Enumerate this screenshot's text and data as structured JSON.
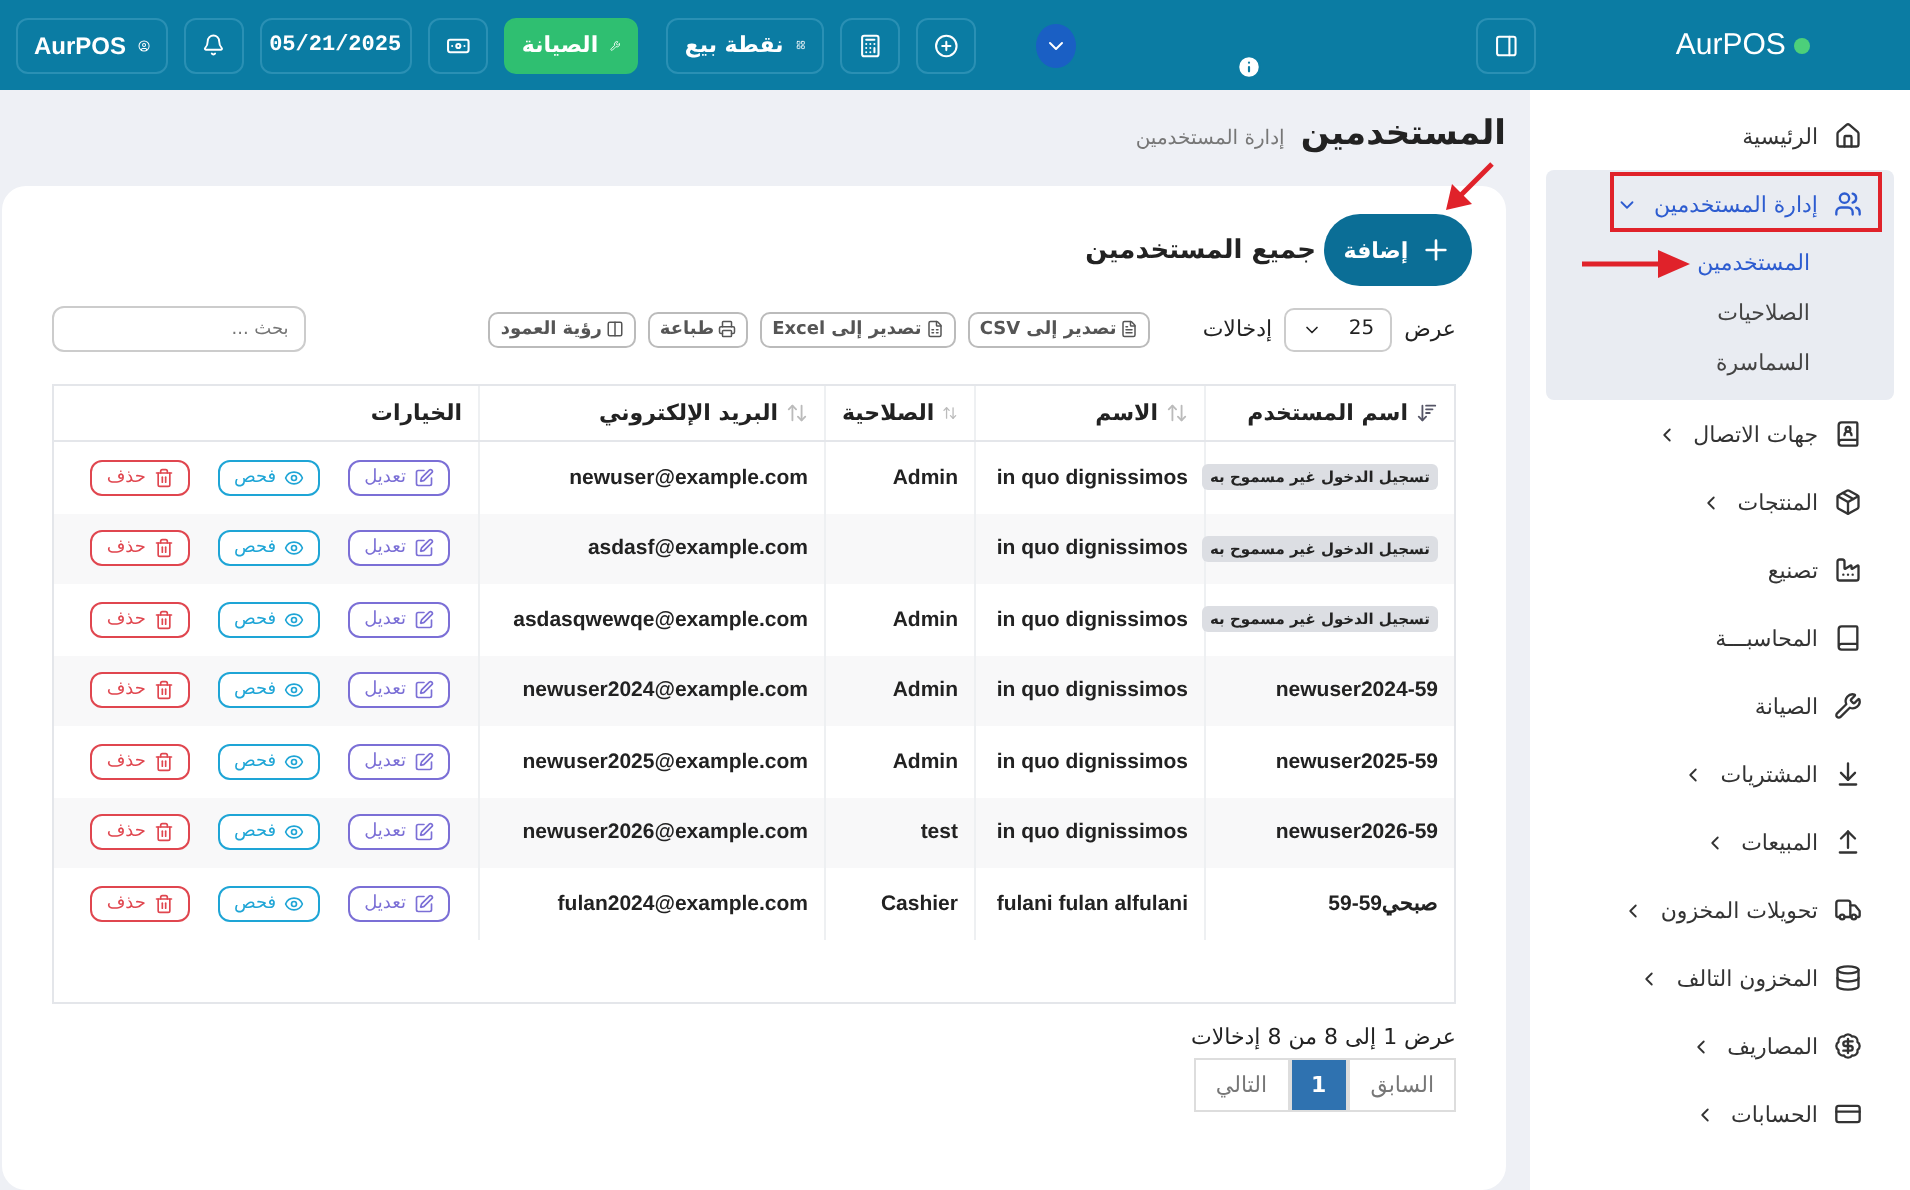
{
  "topbar": {
    "brand": "AurPOS",
    "maintenance_label": "الصيانة",
    "pos_label": "نقطة بيع",
    "date": "05/21/2025",
    "user": "AurPOS"
  },
  "sidebar": {
    "items": [
      {
        "label": "الرئيسية",
        "has_submenu": false,
        "expanded": false
      },
      {
        "label": "إدارة المستخدمين",
        "has_submenu": true,
        "expanded": true,
        "children": [
          {
            "label": "المستخدمين",
            "selected": true
          },
          {
            "label": "الصلاحيات",
            "selected": false
          },
          {
            "label": "السماسرة",
            "selected": false
          }
        ]
      },
      {
        "label": "جهات الاتصال",
        "has_submenu": true,
        "expanded": false
      },
      {
        "label": "المنتجات",
        "has_submenu": true,
        "expanded": false
      },
      {
        "label": "تصنيع",
        "has_submenu": false,
        "expanded": false
      },
      {
        "label": "المحاسبـــة",
        "has_submenu": false,
        "expanded": false
      },
      {
        "label": "الصيانة",
        "has_submenu": false,
        "expanded": false
      },
      {
        "label": "المشتريات",
        "has_submenu": true,
        "expanded": false
      },
      {
        "label": "المبيعات",
        "has_submenu": true,
        "expanded": false
      },
      {
        "label": "تحويلات المخزون",
        "has_submenu": true,
        "expanded": false
      },
      {
        "label": "المخزون التالف",
        "has_submenu": true,
        "expanded": false
      },
      {
        "label": "المصاريف",
        "has_submenu": true,
        "expanded": false
      },
      {
        "label": "الحسابات",
        "has_submenu": true,
        "expanded": false
      }
    ]
  },
  "page": {
    "title": "المستخدمين",
    "breadcrumb": "إدارة المستخدمين"
  },
  "card": {
    "title": "جميع المستخدمين",
    "add_button": "إضافة"
  },
  "controls": {
    "show_label": "عرض",
    "page_size": "25",
    "entries_label": "إدخالات",
    "buttons": [
      {
        "kind": "csv",
        "label": "تصدير إلى CSV"
      },
      {
        "kind": "excel",
        "label": "تصدير إلى Excel"
      },
      {
        "kind": "print",
        "label": "طباعة"
      },
      {
        "kind": "columns",
        "label": "رؤية العمود"
      }
    ],
    "search": {
      "placeholder": "بحث ..."
    }
  },
  "table": {
    "columns": [
      {
        "label": "اسم المستخدم",
        "sortable": true,
        "sorted": true
      },
      {
        "label": "الاسم",
        "sortable": true,
        "sorted": false
      },
      {
        "label": "الصلاحية",
        "sortable": true,
        "sorted": false
      },
      {
        "label": "البريد الإلكتروني",
        "sortable": true,
        "sorted": false
      },
      {
        "label": "الخيارات",
        "sortable": false
      }
    ],
    "rows": [
      {
        "username": {
          "kind": "badge",
          "text": "تسجيل الدخول غير مسموح به"
        },
        "name": "in quo dignissimos",
        "role": "Admin",
        "email": "newuser@example.com",
        "actions": [
          {
            "kind": "edit",
            "label": "تعديل"
          },
          {
            "kind": "view",
            "label": "فحص"
          },
          {
            "kind": "delete",
            "label": "حذف"
          }
        ]
      },
      {
        "username": {
          "kind": "badge",
          "text": "تسجيل الدخول غير مسموح به"
        },
        "name": "in quo dignissimos",
        "email": "asdasf@example.com",
        "actions": [
          {
            "kind": "edit",
            "label": "تعديل"
          },
          {
            "kind": "view",
            "label": "فحص"
          },
          {
            "kind": "delete",
            "label": "حذف"
          }
        ]
      },
      {
        "username": {
          "kind": "badge",
          "text": "تسجيل الدخول غير مسموح به"
        },
        "name": "in quo dignissimos",
        "role": "Admin",
        "email": "asdasqwewqe@example.com",
        "actions": [
          {
            "kind": "edit",
            "label": "تعديل"
          },
          {
            "kind": "view",
            "label": "فحص"
          },
          {
            "kind": "delete",
            "label": "حذف"
          }
        ]
      },
      {
        "username": {
          "kind": "text",
          "text": "newuser2024-59"
        },
        "name": "in quo dignissimos",
        "role": "Admin",
        "email": "newuser2024@example.com",
        "actions": [
          {
            "kind": "edit",
            "label": "تعديل"
          },
          {
            "kind": "view",
            "label": "فحص"
          },
          {
            "kind": "delete",
            "label": "حذف"
          }
        ]
      },
      {
        "username": {
          "kind": "text",
          "text": "newuser2025-59"
        },
        "name": "in quo dignissimos",
        "role": "Admin",
        "email": "newuser2025@example.com",
        "actions": [
          {
            "kind": "edit",
            "label": "تعديل"
          },
          {
            "kind": "view",
            "label": "فحص"
          },
          {
            "kind": "delete",
            "label": "حذف"
          }
        ]
      },
      {
        "username": {
          "kind": "text",
          "text": "newuser2026-59"
        },
        "name": "in quo dignissimos",
        "role": "test",
        "email": "newuser2026@example.com",
        "actions": [
          {
            "kind": "edit",
            "label": "تعديل"
          },
          {
            "kind": "view",
            "label": "فحص"
          },
          {
            "kind": "delete",
            "label": "حذف"
          }
        ]
      },
      {
        "username": {
          "kind": "text",
          "text": "صبحي59-59"
        },
        "name": "fulani fulan alfulani",
        "role": "Cashier",
        "email": "fulan2024@example.com",
        "actions": [
          {
            "kind": "edit",
            "label": "تعديل"
          },
          {
            "kind": "view",
            "label": "فحص"
          },
          {
            "kind": "delete",
            "label": "حذف"
          }
        ]
      }
    ]
  },
  "footer": {
    "info": "عرض 1 إلى 8 من 8 إدخالات",
    "pagination": [
      {
        "label": "السابق",
        "selected": false,
        "disabled": true
      },
      {
        "label": "1",
        "selected": true,
        "disabled": false
      },
      {
        "label": "التالي",
        "selected": false,
        "disabled": true
      }
    ]
  }
}
